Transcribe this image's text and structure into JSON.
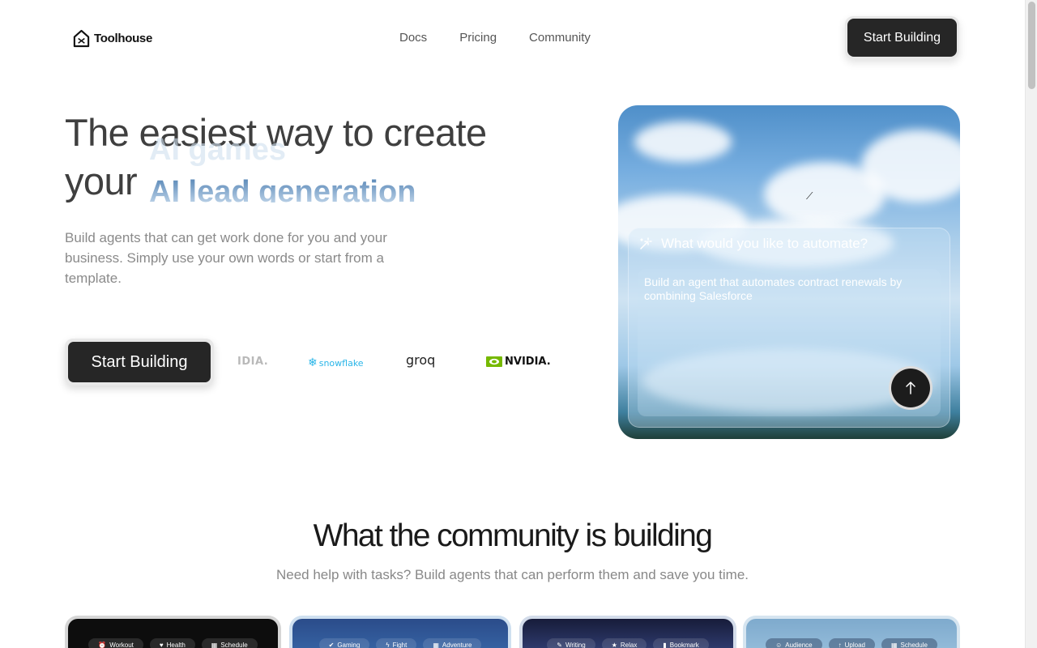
{
  "brand": {
    "name": "Toolhouse"
  },
  "nav": {
    "items": [
      "Docs",
      "Pricing",
      "Community"
    ],
    "cta": "Start Building"
  },
  "hero": {
    "title_line1": "The easiest way to create",
    "title_line2": "your",
    "rotating_prev": "AI games",
    "rotating_current": "AI lead generation",
    "subtitle": "Build agents that can get work done for you and your business. Simply use your own words or start from a template.",
    "cta": "Start Building"
  },
  "partners": {
    "logos": [
      "IDIA.",
      "snowflake",
      "groq",
      "NVIDIA."
    ]
  },
  "prompt_card": {
    "title": "What would you like to automate?",
    "text": "Build an agent that automates contract renewals by combining Salesforce",
    "icon": "magic-wand-icon",
    "send_icon": "arrow-up-icon"
  },
  "community": {
    "title": "What the community is building",
    "subtitle": "Need help with tasks? Build agents that can perform them and save you time.",
    "cards": [
      {
        "chips": [
          "Workout",
          "Health",
          "Schedule"
        ]
      },
      {
        "chips": [
          "Gaming",
          "Fight",
          "Adventure"
        ]
      },
      {
        "chips": [
          "Writing",
          "Relax",
          "Bookmark"
        ]
      },
      {
        "chips": [
          "Audience",
          "Upload",
          "Schedule"
        ]
      }
    ]
  },
  "colors": {
    "primary_button": "#262626",
    "accent_blue": "#5b89b8",
    "snowflake": "#29b5e8",
    "nvidia_green": "#76b900"
  }
}
